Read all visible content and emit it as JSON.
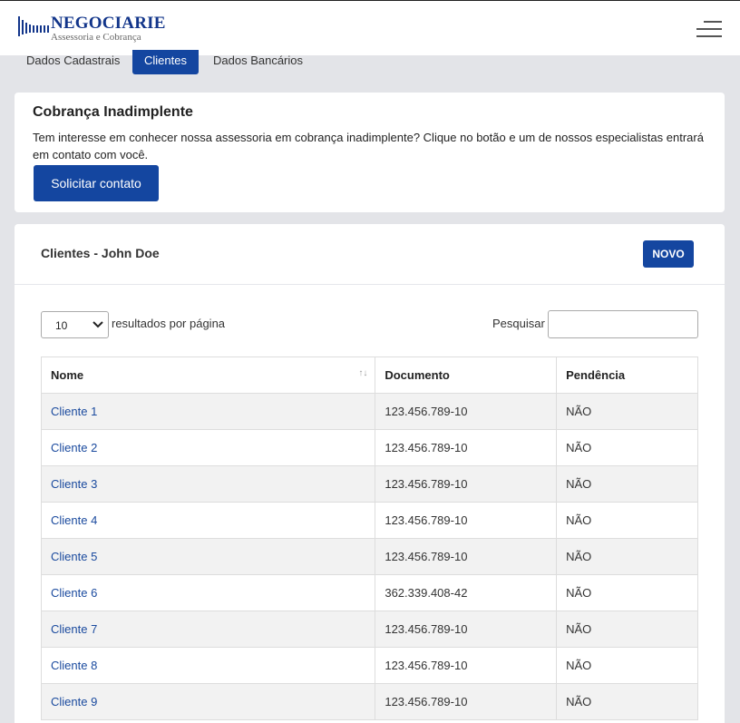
{
  "header": {
    "logo_name": "NEGOCIARIE",
    "logo_tagline": "Assessoria e Cobrança",
    "menu_icon": "hamburger-menu-icon"
  },
  "tabs": [
    {
      "label": "Dados Cadastrais",
      "active": false
    },
    {
      "label": "Clientes",
      "active": true
    },
    {
      "label": "Dados Bancários",
      "active": false
    }
  ],
  "promo": {
    "title": "Cobrança Inadimplente",
    "description": "Tem interesse em conhecer nossa assessoria em cobrança inadimplente? Clique no botão e um de nossos especialistas entrará em contato com você.",
    "button_label": "Solicitar contato"
  },
  "clients_panel": {
    "title": "Clientes - John Doe",
    "new_button_label": "NOVO",
    "page_size_value": "10",
    "page_size_label": "resultados por página",
    "search_label": "Pesquisar",
    "search_value": ""
  },
  "table": {
    "headers": [
      "Nome",
      "Documento",
      "Pendência"
    ],
    "rows": [
      {
        "nome": "Cliente 1",
        "documento": "123.456.789-10",
        "pendencia": "NÃO"
      },
      {
        "nome": "Cliente 2",
        "documento": "123.456.789-10",
        "pendencia": "NÃO"
      },
      {
        "nome": "Cliente 3",
        "documento": "123.456.789-10",
        "pendencia": "NÃO"
      },
      {
        "nome": "Cliente 4",
        "documento": "123.456.789-10",
        "pendencia": "NÃO"
      },
      {
        "nome": "Cliente 5",
        "documento": "123.456.789-10",
        "pendencia": "NÃO"
      },
      {
        "nome": "Cliente 6",
        "documento": "362.339.408-42",
        "pendencia": "NÃO"
      },
      {
        "nome": "Cliente 7",
        "documento": "123.456.789-10",
        "pendencia": "NÃO"
      },
      {
        "nome": "Cliente 8",
        "documento": "123.456.789-10",
        "pendencia": "NÃO"
      },
      {
        "nome": "Cliente 9",
        "documento": "123.456.789-10",
        "pendencia": "NÃO"
      }
    ]
  },
  "colors": {
    "brand_blue": "#1446a0",
    "link_blue": "#1a4a9e",
    "page_bg": "#e3e4e8"
  }
}
